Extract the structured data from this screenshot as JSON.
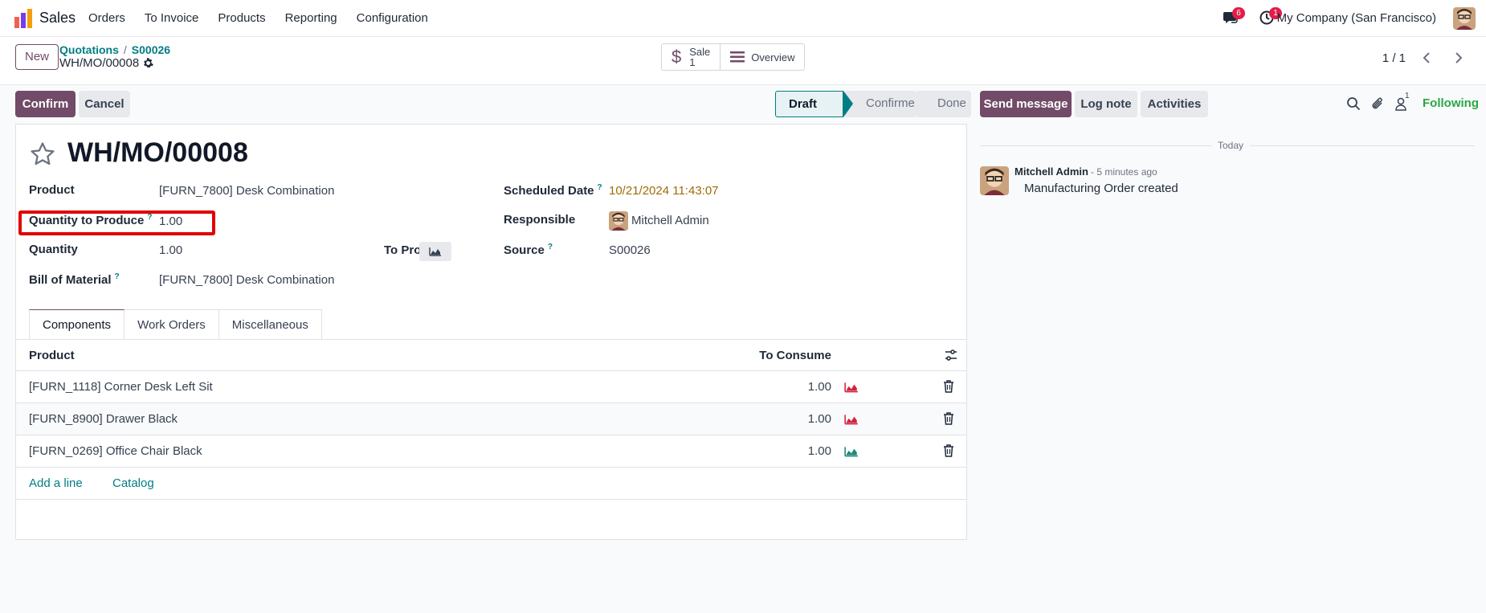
{
  "navbar": {
    "app_name": "Sales",
    "menu": [
      "Orders",
      "To Invoice",
      "Products",
      "Reporting",
      "Configuration"
    ],
    "messages_badge": "6",
    "activities_badge": "1",
    "company": "My Company (San Francisco)"
  },
  "control": {
    "new_label": "New",
    "breadcrumb": [
      "Quotations",
      "S00026"
    ],
    "record_name": "WH/MO/00008",
    "smart_sale_label": "Sale",
    "smart_sale_count": "1",
    "smart_overview_label": "Overview",
    "pager": "1 / 1"
  },
  "actions": {
    "confirm": "Confirm",
    "cancel": "Cancel"
  },
  "status": {
    "stages": [
      "Draft",
      "Confirmed",
      "Done"
    ],
    "current": "Draft"
  },
  "form": {
    "title": "WH/MO/00008",
    "product_label": "Product",
    "product_value": "[FURN_7800] Desk Combination",
    "qty_to_produce_label": "Quantity to Produce",
    "qty_to_produce_value": "1.00",
    "quantity_label": "Quantity",
    "quantity_value": "1.00",
    "to_produce_label": "To Produce",
    "bom_label": "Bill of Material",
    "bom_value": "[FURN_7800] Desk Combination",
    "scheduled_label": "Scheduled Date",
    "scheduled_value": "10/21/2024 11:43:07",
    "responsible_label": "Responsible",
    "responsible_value": "Mitchell Admin",
    "source_label": "Source",
    "source_value": "S00026",
    "help_mark": "?"
  },
  "tabs": [
    "Components",
    "Work Orders",
    "Miscellaneous"
  ],
  "components": {
    "col_product": "Product",
    "col_consume": "To Consume",
    "rows": [
      {
        "product": "[FURN_1118] Corner Desk Left Sit",
        "qty": "1.00",
        "chart_color": "#d6223d"
      },
      {
        "product": "[FURN_8900] Drawer Black",
        "qty": "1.00",
        "chart_color": "#d6223d"
      },
      {
        "product": "[FURN_0269] Office Chair Black",
        "qty": "1.00",
        "chart_color": "#1c8a7a"
      }
    ],
    "add_line": "Add a line",
    "catalog": "Catalog"
  },
  "chatter": {
    "send_message": "Send message",
    "log_note": "Log note",
    "activities": "Activities",
    "followers_count": "1",
    "following": "Following",
    "today": "Today",
    "message": {
      "author": "Mitchell Admin",
      "time": "- 5 minutes ago",
      "body": "Manufacturing Order created"
    }
  }
}
